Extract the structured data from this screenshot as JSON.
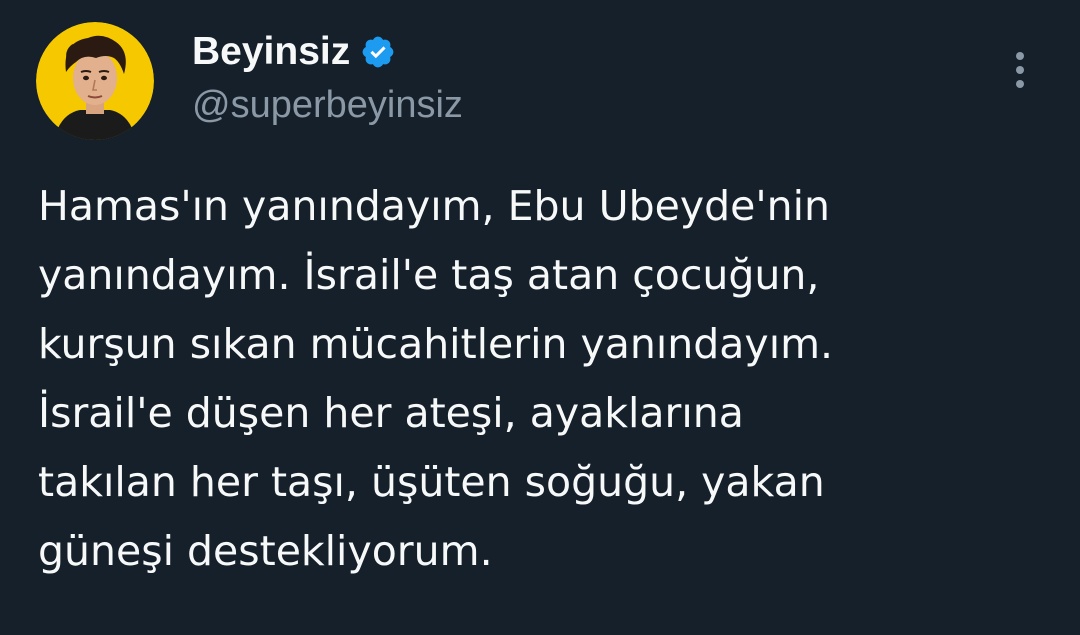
{
  "tweet": {
    "author": {
      "display_name": "Beyinsiz",
      "handle": "@superbeyinsiz",
      "verified": true,
      "verified_color": "#1d9bf0",
      "avatar_background": "#f5c800"
    },
    "text_lines": [
      "Hamas'ın yanındayım, Ebu Ubeyde'nin",
      "yanındayım. İsrail'e taş atan çocuğun,",
      "kurşun sıkan mücahitlerin yanındayım.",
      "İsrail'e düşen her ateşi, ayaklarına",
      "takılan her taşı, üşüten soğuğu, yakan",
      "güneşi destekliyorum."
    ],
    "icons": {
      "more": "more-vertical-icon",
      "verified": "verified-badge-icon"
    }
  },
  "theme": {
    "background": "#15202b",
    "primary_text": "#f7f9f9",
    "secondary_text": "#8b98a5"
  }
}
